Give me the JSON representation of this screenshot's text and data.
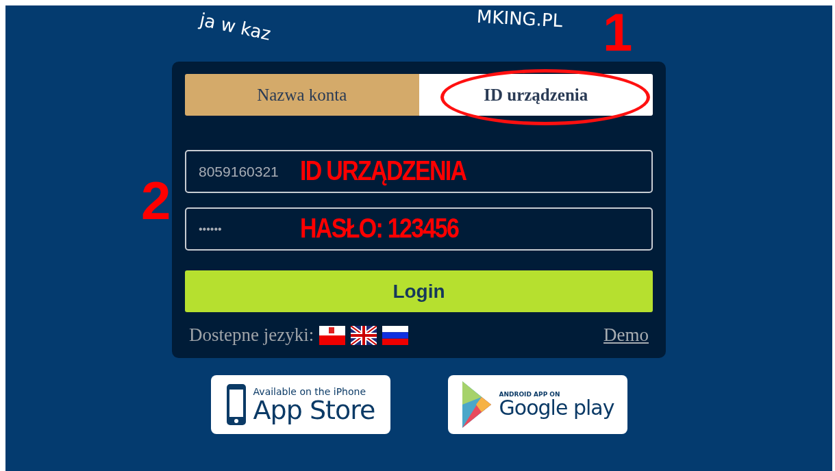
{
  "header": {
    "arc_text_left": "ja w kaz",
    "arc_text_right": "MKING.PL"
  },
  "tabs": [
    {
      "label": "Nazwa konta",
      "selected": false
    },
    {
      "label": "ID urządzenia",
      "selected": true
    }
  ],
  "form": {
    "device_id": "8059160321",
    "password": "••••••",
    "login_button": "Login",
    "languages_label": "Dostepne jezyki:",
    "languages": [
      {
        "kind": "pl"
      },
      {
        "kind": "gb"
      },
      {
        "kind": "ru"
      }
    ],
    "demo_link": "Demo"
  },
  "store_badges": [
    {
      "kind": "apple",
      "small_text": "Available on the iPhone",
      "big_text": "App Store"
    },
    {
      "kind": "google",
      "small_text": "ANDROID APP ON",
      "big_text": "Google",
      "extra_text": "play"
    }
  ],
  "annotations": [
    {
      "kind": "number",
      "text": "1"
    },
    {
      "kind": "number",
      "text": "2"
    },
    {
      "kind": "field",
      "text": "ID URZĄDZENIA"
    },
    {
      "kind": "field",
      "text": "HASŁO: 123456"
    }
  ]
}
